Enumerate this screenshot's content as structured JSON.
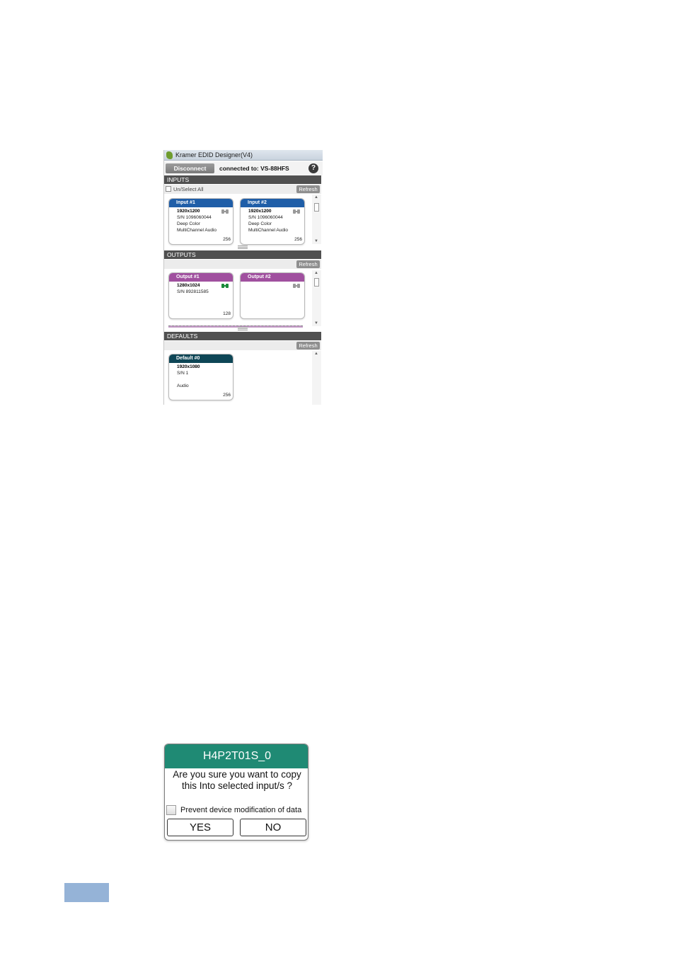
{
  "app": {
    "title": "Kramer EDID Designer(V4)",
    "disconnect_label": "Disconnect",
    "connected_text": "connected to: VS-88HFS",
    "help_glyph": "?"
  },
  "inputs": {
    "header": "INPUTS",
    "select_all_label": "Un/Select All",
    "refresh_label": "Refresh",
    "cards": [
      {
        "title": "Input #1",
        "resolution": "1920x1200",
        "serial": "S/N 1096060044",
        "feature1": "Deep Color",
        "feature2": "MultiChannel Audio",
        "size": "256",
        "plug_color": "#9a9a9a"
      },
      {
        "title": "Input #2",
        "resolution": "1920x1200",
        "serial": "S/N 1096060044",
        "feature1": "Deep Color",
        "feature2": "MultiChannel Audio",
        "size": "256",
        "plug_color": "#9a9a9a"
      }
    ],
    "header_color": "#1f5ea8"
  },
  "outputs": {
    "header": "OUTPUTS",
    "refresh_label": "Refresh",
    "cards": [
      {
        "title": "Output #1",
        "resolution": "1280x1024",
        "serial": "S/N 892811585",
        "size": "128",
        "plug_color": "#1a8a3a"
      },
      {
        "title": "Output #2",
        "plug_color": "#9a9a9a"
      }
    ],
    "header_color": "#a0509f"
  },
  "defaults": {
    "header": "DEFAULTS",
    "refresh_label": "Refresh",
    "cards": [
      {
        "title": "Default #0",
        "resolution": "1920x1080",
        "serial": "S/N 1",
        "feature": "Audio",
        "size": "256"
      }
    ],
    "header_color": "#0e4656"
  },
  "dialog": {
    "title": "H4P2T01S_0",
    "message_line1": "Are you sure you want to copy",
    "message_line2": "this Into selected input/s ?",
    "checkbox_label": "Prevent device modification of data",
    "yes_label": "YES",
    "no_label": "NO",
    "title_color": "#1f8a74"
  }
}
